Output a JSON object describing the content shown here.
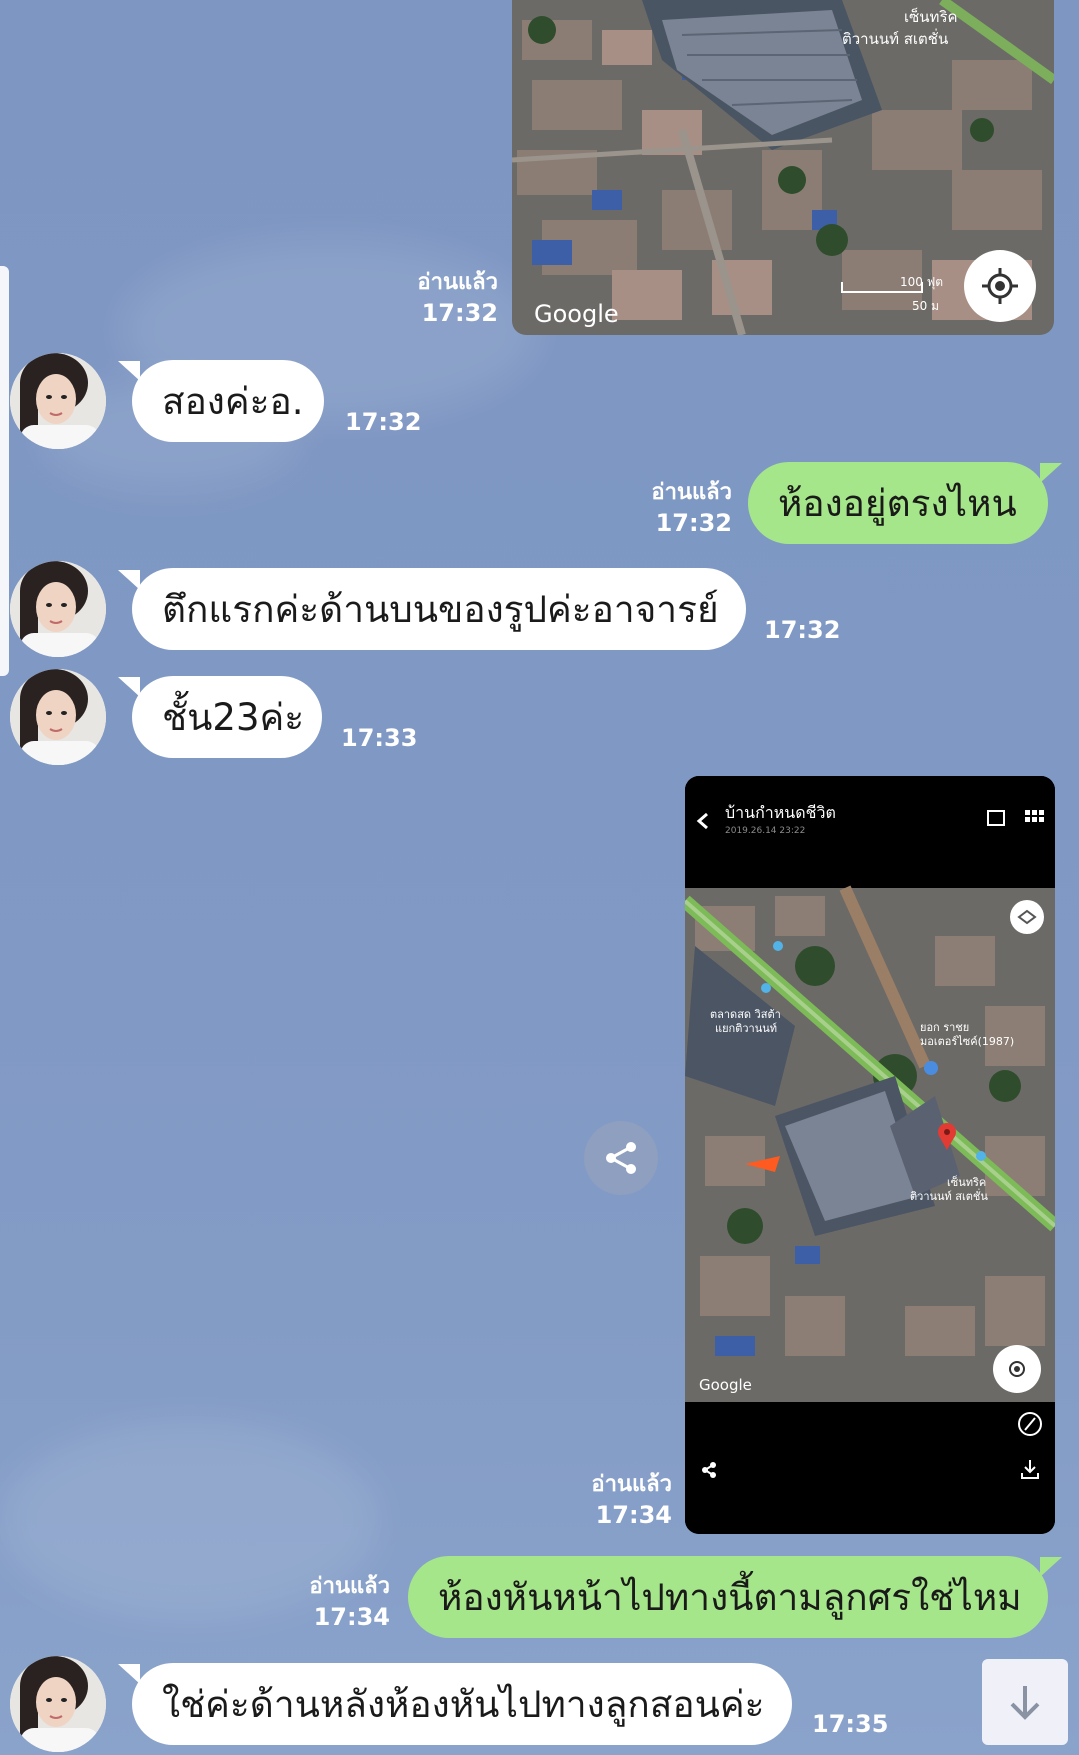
{
  "chat": {
    "messages": [
      {
        "id": "m1",
        "sender": "me",
        "type": "image",
        "read_label": "อ่านแล้ว",
        "time": "17:32",
        "map_brand": "Google",
        "map_labels": [
          "เซ็นทริค",
          "ติวานนท์ สเตชั่น"
        ],
        "scale_labels": [
          "100 ฟุต",
          "50 ม"
        ]
      },
      {
        "id": "m2",
        "sender": "contact",
        "type": "text",
        "text": "สองค่ะอ.",
        "time": "17:32"
      },
      {
        "id": "m3",
        "sender": "me",
        "type": "text",
        "text": "ห้องอยู่ตรงไหน",
        "read_label": "อ่านแล้ว",
        "time": "17:32"
      },
      {
        "id": "m4",
        "sender": "contact",
        "type": "text",
        "text": "ตึกแรกค่ะด้านบนของรูปค่ะอาจารย์",
        "time": "17:32"
      },
      {
        "id": "m5",
        "sender": "contact",
        "type": "text",
        "text": "ชั้น23ค่ะ",
        "time": "17:33"
      },
      {
        "id": "m6",
        "sender": "me",
        "type": "image",
        "read_label": "อ่านแล้ว",
        "time": "17:34",
        "screenshot_title": "บ้านกำหนดชีวิต",
        "screenshot_subtitle": "2019.26.14 23:22",
        "map_brand": "Google",
        "map_labels": [
          "ตลาดสด วิสต้า",
          "แยกติวานนท์",
          "ยอก ราชย",
          "มอเตอร์ไซค์(1987)",
          "เซ็นทริค",
          "ติวานนท์ สเตชั่น"
        ]
      },
      {
        "id": "m7",
        "sender": "me",
        "type": "text",
        "text": "ห้องหันหน้าไปทางนี้ตามลูกศรใช่ไหม",
        "read_label": "อ่านแล้ว",
        "time": "17:34"
      },
      {
        "id": "m8",
        "sender": "contact",
        "type": "text",
        "text": "ใช่ค่ะด้านหลังห้องหันไปทางลูกสอนค่ะ",
        "time": "17:35"
      }
    ]
  },
  "icons": {
    "locate": "crosshair-icon",
    "share": "share-icon",
    "scroll": "arrow-down-icon"
  },
  "colors": {
    "background": "#7f98c4",
    "incoming_bubble": "#ffffff",
    "outgoing_bubble": "#a6e68a",
    "meta_text": "#ffffff"
  }
}
